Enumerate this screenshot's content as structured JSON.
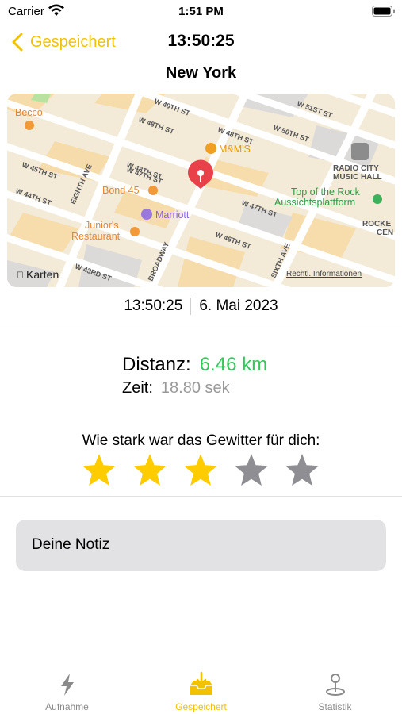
{
  "status_bar": {
    "carrier": "Carrier",
    "time": "1:51 PM"
  },
  "nav": {
    "back_label": "Gespeichert",
    "title": "13:50:25"
  },
  "location": {
    "city": "New York"
  },
  "map": {
    "attribution": "Karten",
    "legal": "Rechtl. Informationen",
    "streets": [
      "W 49TH ST",
      "W 48TH ST",
      "W 47TH ST",
      "W 46TH ST",
      "W 45TH ST",
      "W 44TH ST",
      "W 43RD ST",
      "W 51ST ST",
      "W 50TH ST",
      "EIGHTH AVE",
      "BROADWAY",
      "SIXTH AVE"
    ],
    "pois": {
      "becco": "Becco",
      "mms": "M&M'S",
      "bond45": "Bond 45",
      "marriott": "Marriott",
      "juniors_1": "Junior's",
      "juniors_2": "Restaurant",
      "radio_1": "RADIO CITY",
      "radio_2": "MUSIC HALL",
      "rock_1": "Top of the Rock",
      "rock_2": "Aussichtsplattform",
      "rocke_1": "ROCKE",
      "rocke_2": "CEN"
    }
  },
  "record": {
    "time": "13:50:25",
    "date": "6. Mai 2023"
  },
  "stats": {
    "distance_label": "Distanz:",
    "distance_value": "6.46 km",
    "time_label": "Zeit:",
    "time_value": "18.80 sek"
  },
  "rating": {
    "question": "Wie stark war das Gewitter für dich:",
    "value": 3,
    "max": 5
  },
  "note": {
    "placeholder": "Deine Notiz"
  },
  "tabs": [
    {
      "label": "Aufnahme",
      "icon": "bolt-icon",
      "active": false
    },
    {
      "label": "Gespeichert",
      "icon": "tray-download-icon",
      "active": true
    },
    {
      "label": "Statistik",
      "icon": "map-pin-icon",
      "active": false
    }
  ],
  "colors": {
    "accent": "#f2c200",
    "distance": "#34c759",
    "muted": "#999999",
    "star_on": "#ffcc00",
    "star_off": "#8e8e93",
    "pin": "#e8414a"
  }
}
